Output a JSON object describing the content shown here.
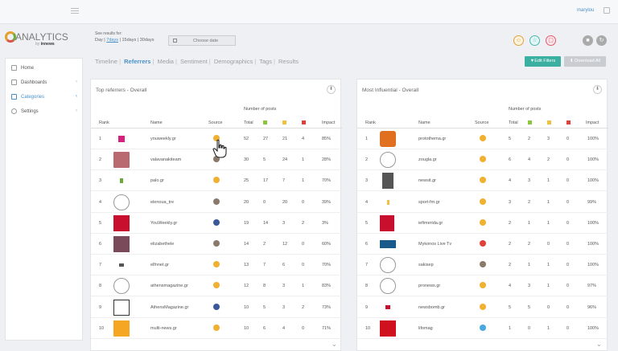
{
  "user": {
    "name": "marylou"
  },
  "logo": {
    "title": "ANALYTICS",
    "by": "by",
    "brand": "innews"
  },
  "period": {
    "heading": "See results for:",
    "options": [
      "Day",
      "7days",
      "15days",
      "30days"
    ],
    "selected": "7days",
    "date_placeholder": "Choose date"
  },
  "sidebar": {
    "items": [
      {
        "label": "Home",
        "icon": "home-icon",
        "chevron": "",
        "active": false
      },
      {
        "label": "Dashboards",
        "icon": "dashboard-icon",
        "chevron": "‹",
        "active": false
      },
      {
        "label": "Categories",
        "icon": "tag-icon",
        "chevron": "‹",
        "active": true
      },
      {
        "label": "Settings",
        "icon": "gear-icon",
        "chevron": "‹",
        "active": false
      }
    ]
  },
  "tabs": [
    "Timeline",
    "Referrers",
    "Media",
    "Sentiment",
    "Demographics",
    "Tags",
    "Results"
  ],
  "active_tab": "Referrers",
  "buttons": {
    "edit_filters": "▼Edit Filters",
    "download_all": "⬇ Download All"
  },
  "colors": {
    "accent": "#4a90c8",
    "teal": "#3bb0a0",
    "positive": "#8cc63f",
    "neutral": "#f0c040",
    "negative": "#e0403a"
  },
  "left_panel": {
    "title": "Top referrers - Overall",
    "group_header": "Number of posts",
    "columns": [
      "Rank",
      "Name",
      "Source",
      "Total",
      "Impact"
    ],
    "rows": [
      {
        "rank": "1",
        "name": "youweekly.gr",
        "source": "web",
        "total": "52",
        "pos": "27",
        "neu": "21",
        "neg": "4",
        "impact": "85%"
      },
      {
        "rank": "2",
        "name": "valavanakiteam",
        "source": "instagram",
        "total": "30",
        "pos": "5",
        "neu": "24",
        "neg": "1",
        "impact": "28%"
      },
      {
        "rank": "3",
        "name": "palo.gr",
        "source": "web",
        "total": "25",
        "pos": "17",
        "neu": "7",
        "neg": "1",
        "impact": "70%"
      },
      {
        "rank": "4",
        "name": "elenoua_tre",
        "source": "instagram",
        "total": "20",
        "pos": "0",
        "neu": "20",
        "neg": "0",
        "impact": "39%"
      },
      {
        "rank": "5",
        "name": "YouWeekly.gr",
        "source": "facebook",
        "total": "19",
        "pos": "14",
        "neu": "3",
        "neg": "2",
        "impact": "3%"
      },
      {
        "rank": "6",
        "name": "elizabethele",
        "source": "instagram",
        "total": "14",
        "pos": "2",
        "neu": "12",
        "neg": "0",
        "impact": "60%"
      },
      {
        "rank": "7",
        "name": "elfnnet.gr",
        "source": "web",
        "total": "13",
        "pos": "7",
        "neu": "6",
        "neg": "0",
        "impact": "70%"
      },
      {
        "rank": "8",
        "name": "athensmagazine.gr",
        "source": "web",
        "total": "12",
        "pos": "8",
        "neu": "3",
        "neg": "1",
        "impact": "83%"
      },
      {
        "rank": "9",
        "name": "AthensMagazine.gr",
        "source": "facebook",
        "total": "10",
        "pos": "5",
        "neu": "3",
        "neg": "2",
        "impact": "73%"
      },
      {
        "rank": "10",
        "name": "multi-news.gr",
        "source": "web",
        "total": "10",
        "pos": "6",
        "neu": "4",
        "neg": "0",
        "impact": "71%"
      }
    ]
  },
  "right_panel": {
    "title": "Most Influential - Overall",
    "group_header": "Number of posts",
    "columns": [
      "Rank",
      "Name",
      "Source",
      "Total",
      "Impact"
    ],
    "rows": [
      {
        "rank": "1",
        "name": "protothema.gr",
        "source": "web",
        "total": "5",
        "pos": "2",
        "neu": "3",
        "neg": "0",
        "impact": "100%"
      },
      {
        "rank": "2",
        "name": "zougla.gr",
        "source": "web",
        "total": "6",
        "pos": "4",
        "neu": "2",
        "neg": "0",
        "impact": "100%"
      },
      {
        "rank": "3",
        "name": "newsit.gr",
        "source": "web",
        "total": "4",
        "pos": "3",
        "neu": "1",
        "neg": "0",
        "impact": "100%"
      },
      {
        "rank": "4",
        "name": "sport-fm.gr",
        "source": "web",
        "total": "3",
        "pos": "2",
        "neu": "1",
        "neg": "0",
        "impact": "99%"
      },
      {
        "rank": "5",
        "name": "iefimerida.gr",
        "source": "web",
        "total": "2",
        "pos": "1",
        "neu": "1",
        "neg": "0",
        "impact": "100%"
      },
      {
        "rank": "6",
        "name": "Mykonos Live Tv",
        "source": "youtube",
        "total": "2",
        "pos": "2",
        "neu": "0",
        "neg": "0",
        "impact": "100%"
      },
      {
        "rank": "7",
        "name": "sakisep",
        "source": "instagram",
        "total": "2",
        "pos": "1",
        "neu": "1",
        "neg": "0",
        "impact": "100%"
      },
      {
        "rank": "8",
        "name": "pronews.gr",
        "source": "web",
        "total": "4",
        "pos": "3",
        "neu": "1",
        "neg": "0",
        "impact": "97%"
      },
      {
        "rank": "9",
        "name": "newsbomb.gr",
        "source": "web",
        "total": "5",
        "pos": "5",
        "neu": "0",
        "neg": "0",
        "impact": "96%"
      },
      {
        "rank": "10",
        "name": "lifomag",
        "source": "twitter",
        "total": "1",
        "pos": "0",
        "neu": "1",
        "neg": "0",
        "impact": "100%"
      }
    ]
  }
}
